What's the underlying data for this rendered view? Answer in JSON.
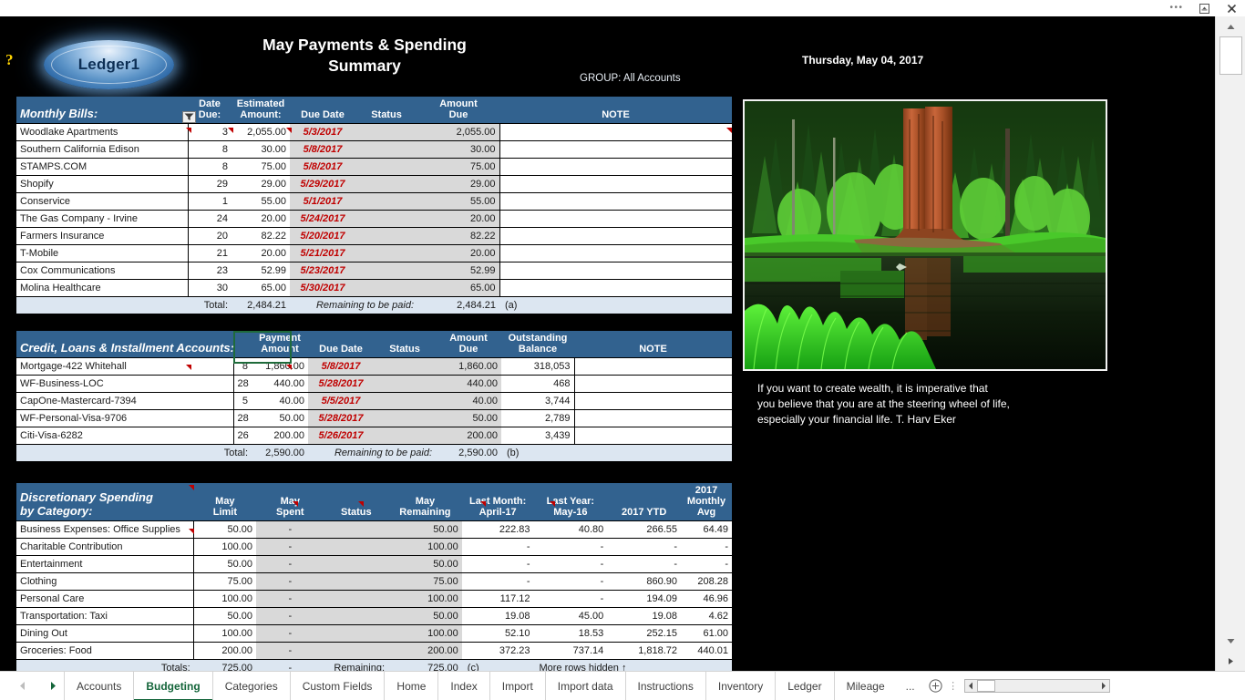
{
  "window": {
    "chrome_dots": "•••",
    "restore_icon": "restore-window-icon",
    "close_icon": "close-window-icon"
  },
  "header": {
    "help_glyph": "?",
    "logo_text": "Ledger1",
    "title_line1": "May Payments & Spending",
    "title_line2": "Summary",
    "group_label": "GROUP:  All Accounts",
    "today": "Thursday, May 04, 2017"
  },
  "monthly_bills": {
    "section_title": "Monthly Bills:",
    "columns": [
      {
        "top": "Date",
        "sub": "Due:"
      },
      {
        "top": "Estimated",
        "sub": "Amount:"
      },
      {
        "top": "",
        "sub": "Due Date"
      },
      {
        "top": "",
        "sub": "Status"
      },
      {
        "top": "Amount",
        "sub": "Due"
      },
      {
        "top": "",
        "sub": "NOTE"
      }
    ],
    "rows": [
      {
        "name": "Woodlake Apartments",
        "date_due": "3",
        "estimated": "2,055.00",
        "due_date": "5/3/2017",
        "status": "",
        "amount_due": "2,055.00",
        "note": ""
      },
      {
        "name": "Southern California Edison",
        "date_due": "8",
        "estimated": "30.00",
        "due_date": "5/8/2017",
        "status": "",
        "amount_due": "30.00",
        "note": ""
      },
      {
        "name": "STAMPS.COM",
        "date_due": "8",
        "estimated": "75.00",
        "due_date": "5/8/2017",
        "status": "",
        "amount_due": "75.00",
        "note": ""
      },
      {
        "name": "Shopify",
        "date_due": "29",
        "estimated": "29.00",
        "due_date": "5/29/2017",
        "status": "",
        "amount_due": "29.00",
        "note": ""
      },
      {
        "name": "Conservice",
        "date_due": "1",
        "estimated": "55.00",
        "due_date": "5/1/2017",
        "status": "",
        "amount_due": "55.00",
        "note": ""
      },
      {
        "name": "The Gas Company - Irvine",
        "date_due": "24",
        "estimated": "20.00",
        "due_date": "5/24/2017",
        "status": "",
        "amount_due": "20.00",
        "note": ""
      },
      {
        "name": "Farmers Insurance",
        "date_due": "20",
        "estimated": "82.22",
        "due_date": "5/20/2017",
        "status": "",
        "amount_due": "82.22",
        "note": ""
      },
      {
        "name": "T-Mobile",
        "date_due": "21",
        "estimated": "20.00",
        "due_date": "5/21/2017",
        "status": "",
        "amount_due": "20.00",
        "note": ""
      },
      {
        "name": "Cox Communications",
        "date_due": "23",
        "estimated": "52.99",
        "due_date": "5/23/2017",
        "status": "",
        "amount_due": "52.99",
        "note": ""
      },
      {
        "name": "Molina Healthcare",
        "date_due": "30",
        "estimated": "65.00",
        "due_date": "5/30/2017",
        "status": "",
        "amount_due": "65.00",
        "note": ""
      }
    ],
    "totals": {
      "label": "Total:",
      "total": "2,484.21",
      "remaining_label": "Remaining to be paid:",
      "remaining": "2,484.21",
      "tag": "(a)"
    }
  },
  "credit_accounts": {
    "section_title": "Credit, Loans & Installment Accounts:",
    "columns": [
      {
        "top": "",
        "sub": ""
      },
      {
        "top": "Payment",
        "sub": "Amount"
      },
      {
        "top": "",
        "sub": "Due Date"
      },
      {
        "top": "",
        "sub": "Status"
      },
      {
        "top": "Amount",
        "sub": "Due"
      },
      {
        "top": "Outstanding",
        "sub": "Balance"
      },
      {
        "top": "",
        "sub": "NOTE"
      }
    ],
    "rows": [
      {
        "name": "Mortgage-422 Whitehall",
        "date_due": "8",
        "payment": "1,860.00",
        "due_date": "5/8/2017",
        "status": "",
        "amount_due": "1,860.00",
        "balance": "318,053",
        "note": ""
      },
      {
        "name": "WF-Business-LOC",
        "date_due": "28",
        "payment": "440.00",
        "due_date": "5/28/2017",
        "status": "",
        "amount_due": "440.00",
        "balance": "468",
        "note": ""
      },
      {
        "name": "CapOne-Mastercard-7394",
        "date_due": "5",
        "payment": "40.00",
        "due_date": "5/5/2017",
        "status": "",
        "amount_due": "40.00",
        "balance": "3,744",
        "note": ""
      },
      {
        "name": "WF-Personal-Visa-9706",
        "date_due": "28",
        "payment": "50.00",
        "due_date": "5/28/2017",
        "status": "",
        "amount_due": "50.00",
        "balance": "2,789",
        "note": ""
      },
      {
        "name": "Citi-Visa-6282",
        "date_due": "26",
        "payment": "200.00",
        "due_date": "5/26/2017",
        "status": "",
        "amount_due": "200.00",
        "balance": "3,439",
        "note": ""
      }
    ],
    "totals": {
      "label": "Total:",
      "total": "2,590.00",
      "remaining_label": "Remaining to be paid:",
      "remaining": "2,590.00",
      "tag": "(b)"
    }
  },
  "discretionary": {
    "section_title_line1": "Discretionary Spending",
    "section_title_line2": "by Category:",
    "columns": [
      {
        "top": "May",
        "mid": "Limit",
        "bot": ""
      },
      {
        "top": "May",
        "mid": "Spent",
        "bot": ""
      },
      {
        "top": "",
        "mid": "Status",
        "bot": ""
      },
      {
        "top": "May",
        "mid": "Remaining",
        "bot": ""
      },
      {
        "top": "Last Month:",
        "mid": "April-17",
        "bot": ""
      },
      {
        "top": "Last Year:",
        "mid": "May-16",
        "bot": ""
      },
      {
        "top": "",
        "mid": "2017 YTD",
        "bot": ""
      },
      {
        "top": "2017",
        "mid": "Monthly",
        "bot": "Avg"
      }
    ],
    "rows": [
      {
        "name": "Business Expenses: Office Supplies",
        "limit": "50.00",
        "spent": "-",
        "status": "",
        "remaining": "50.00",
        "last_month": "222.83",
        "last_year": "40.80",
        "ytd": "266.55",
        "monthly_avg": "64.49"
      },
      {
        "name": "Charitable Contribution",
        "limit": "100.00",
        "spent": "-",
        "status": "",
        "remaining": "100.00",
        "last_month": "-",
        "last_year": "-",
        "ytd": "-",
        "monthly_avg": "-"
      },
      {
        "name": "Entertainment",
        "limit": "50.00",
        "spent": "-",
        "status": "",
        "remaining": "50.00",
        "last_month": "-",
        "last_year": "-",
        "ytd": "-",
        "monthly_avg": "-"
      },
      {
        "name": "Clothing",
        "limit": "75.00",
        "spent": "-",
        "status": "",
        "remaining": "75.00",
        "last_month": "-",
        "last_year": "-",
        "ytd": "860.90",
        "monthly_avg": "208.28"
      },
      {
        "name": "Personal Care",
        "limit": "100.00",
        "spent": "-",
        "status": "",
        "remaining": "100.00",
        "last_month": "117.12",
        "last_year": "-",
        "ytd": "194.09",
        "monthly_avg": "46.96"
      },
      {
        "name": "Transportation: Taxi",
        "limit": "50.00",
        "spent": "-",
        "status": "",
        "remaining": "50.00",
        "last_month": "19.08",
        "last_year": "45.00",
        "ytd": "19.08",
        "monthly_avg": "4.62"
      },
      {
        "name": "Dining Out",
        "limit": "100.00",
        "spent": "-",
        "status": "",
        "remaining": "100.00",
        "last_month": "52.10",
        "last_year": "18.53",
        "ytd": "252.15",
        "monthly_avg": "61.00"
      },
      {
        "name": "Groceries: Food",
        "limit": "200.00",
        "spent": "-",
        "status": "",
        "remaining": "200.00",
        "last_month": "372.23",
        "last_year": "737.14",
        "ytd": "1,818.72",
        "monthly_avg": "440.01"
      }
    ],
    "totals": {
      "label": "Totals:",
      "limit": "725.00",
      "spent": "-",
      "remaining_label": "Remaining:",
      "remaining": "725.00",
      "tag": "(c)",
      "more": "More rows hidden ↑"
    }
  },
  "quote": {
    "line1": "If you want to create wealth, it is imperative that",
    "line2": "you believe that you are at the steering wheel of life,",
    "line3": "especially your financial life.  T. Harv Eker"
  },
  "tabbar": {
    "prev_label": "◂",
    "next_label": "▸",
    "tabs": [
      {
        "label": "Accounts",
        "active": false
      },
      {
        "label": "Budgeting",
        "active": true
      },
      {
        "label": "Categories",
        "active": false
      },
      {
        "label": "Custom Fields",
        "active": false
      },
      {
        "label": "Home",
        "active": false
      },
      {
        "label": "Index",
        "active": false
      },
      {
        "label": "Import",
        "active": false
      },
      {
        "label": "Import data",
        "active": false
      },
      {
        "label": "Instructions",
        "active": false
      },
      {
        "label": "Inventory",
        "active": false
      },
      {
        "label": "Ledger",
        "active": false
      },
      {
        "label": "Mileage",
        "active": false
      }
    ],
    "more": "...",
    "add_label": "+"
  },
  "colors": {
    "header_blue": "#32628f",
    "total_blue": "#dce6f1",
    "shade_gray": "#d9d9d9",
    "due_red": "#c00000",
    "tab_green": "#14653a",
    "canvas_black": "#000000"
  }
}
